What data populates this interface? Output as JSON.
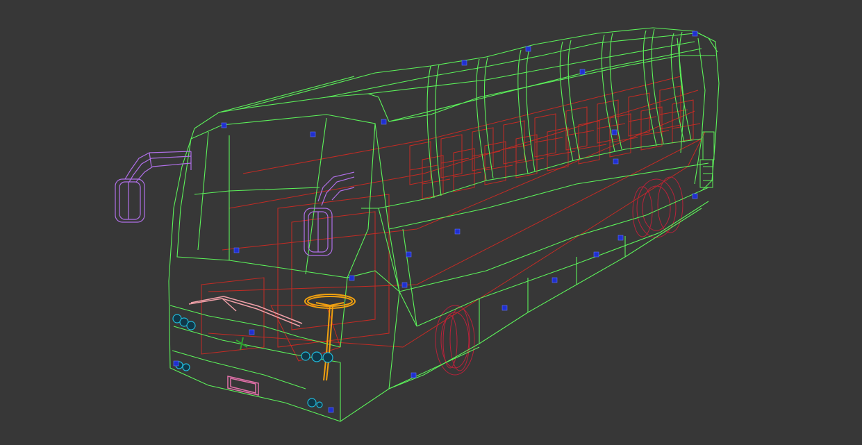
{
  "viewport": {
    "background": "#373737",
    "model": "bus-wireframe"
  },
  "colors": {
    "body_wire": "#5cf25a",
    "interior_wire": "#d42a22",
    "wheel_wire": "#b8223a",
    "mirror_wire": "#b070e8",
    "steering_wheel": "#f0a010",
    "wiper": "#f0a0a8",
    "lights": "#20b8d8",
    "markers": "#2030d0",
    "plate": "#e070a8"
  }
}
